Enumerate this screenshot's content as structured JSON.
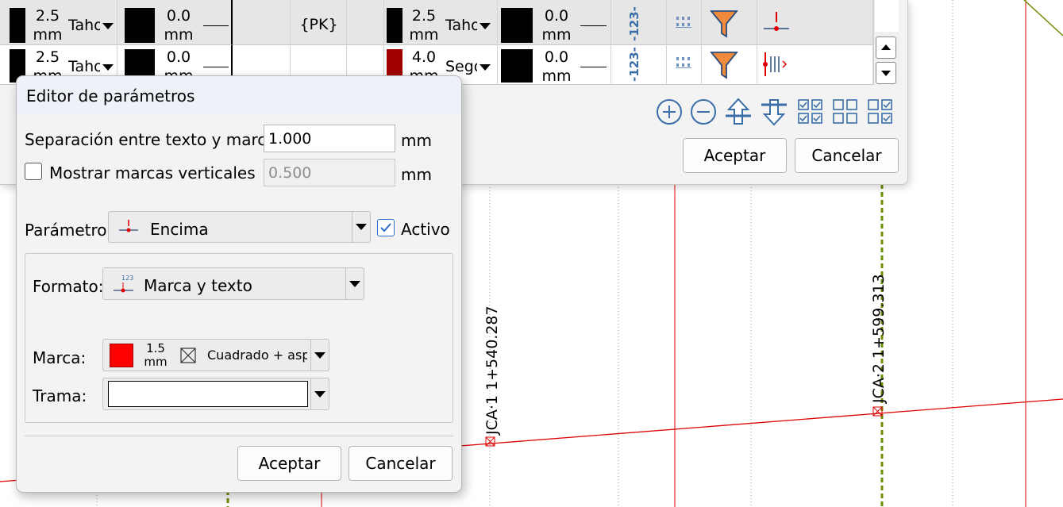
{
  "background": {
    "station_labels": [
      "JCA·1 1+540.287",
      "JCA·2 1+599.313"
    ]
  },
  "table_dialog": {
    "rows": [
      {
        "size_a": "2.5",
        "unit_a": "mm",
        "font_a": "Tahoma",
        "offset_a": "0.0",
        "unit_off_a": "mm",
        "pk": "{PK}",
        "size_b": "2.5",
        "unit_b": "mm",
        "font_b": "Tahoma",
        "offset_b": "0.0",
        "unit_off_b": "mm",
        "color_b": "#000000"
      },
      {
        "size_a": "2.5",
        "unit_a": "mm",
        "font_a": "Tahoma",
        "offset_a": "0.0",
        "unit_off_a": "mm",
        "pk": "",
        "size_b": "4.0",
        "unit_b": "mm",
        "font_b": "Segoe",
        "offset_b": "0.0",
        "unit_off_b": "mm",
        "color_b": "#a00000"
      }
    ],
    "numeric_icon_text": "-123-",
    "toolbar_icons": [
      "add-icon",
      "remove-icon",
      "move-up-icon",
      "move-down-icon",
      "check-all-icon",
      "uncheck-all-icon",
      "toggle-check-icon"
    ],
    "accept_label": "Aceptar",
    "cancel_label": "Cancelar"
  },
  "editor": {
    "title": "Editor de parámetros",
    "separation_label": "Separación entre texto y marco:",
    "separation_value": "1.000",
    "separation_unit": "mm",
    "vertical_marks_label": "Mostrar marcas verticales",
    "vertical_marks_checked": false,
    "vertical_marks_value": "0.500",
    "vertical_marks_unit": "mm",
    "parameter_label": "Parámetro:",
    "parameter_value": "Encima",
    "active_label": "Activo",
    "active_checked": true,
    "format_label": "Formato:",
    "format_icon_text": "123",
    "format_value": "Marca y texto",
    "mark_label": "Marca:",
    "mark_color": "#ff0000",
    "mark_size": "1.5",
    "mark_size_unit": "mm",
    "mark_style": "Cuadrado + aspa",
    "hatch_label": "Trama:",
    "accept_label": "Aceptar",
    "cancel_label": "Cancelar"
  },
  "colors": {
    "accent": "#2a6fc9",
    "axis_line": "#e00000",
    "filter_orange": "#f08a3c",
    "icon_blue": "#3a6ea8",
    "guide_green": "#6b8e00"
  }
}
